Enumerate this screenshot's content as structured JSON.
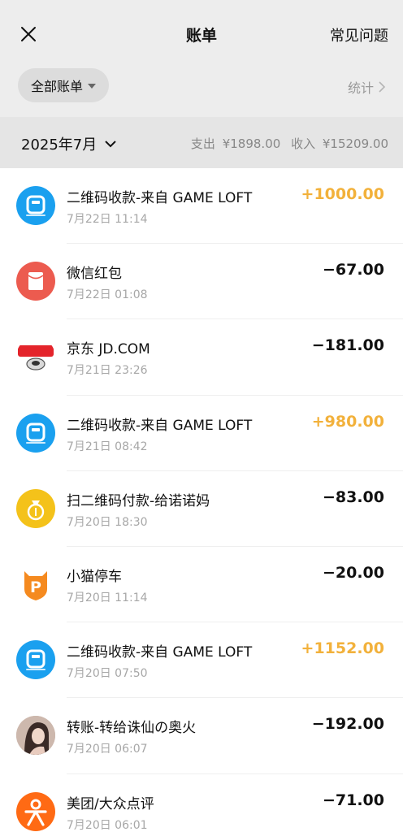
{
  "header": {
    "title": "账单",
    "faq_label": "常见问题"
  },
  "filter": {
    "all_bills_label": "全部账单",
    "stats_label": "统计"
  },
  "month_bar": {
    "month_label": "2025年7月",
    "expense_label": "支出",
    "expense_value": "¥1898.00",
    "income_label": "收入",
    "income_value": "¥15209.00"
  },
  "colors": {
    "income_amount": "#f2b13b",
    "gameloft_icon": "#1aa0ef",
    "red_packet_icon": "#ec5b4f",
    "scan_icon": "#f4c21a",
    "meituan_icon": "#ff6a14"
  },
  "transactions": [
    {
      "icon": "gameloft-icon",
      "name": "二维码收款-来自 GAME LOFT",
      "time": "7月22日 11:14",
      "amount": "+1000.00",
      "type": "income"
    },
    {
      "icon": "red-packet-icon",
      "name": "微信红包",
      "time": "7月22日 01:08",
      "amount": "−67.00",
      "type": "expense"
    },
    {
      "icon": "jd-logo-icon",
      "name": "京东 JD.COM",
      "time": "7月21日 23:26",
      "amount": "−181.00",
      "type": "expense"
    },
    {
      "icon": "gameloft-icon",
      "name": "二维码收款-来自 GAME LOFT",
      "time": "7月21日 08:42",
      "amount": "+980.00",
      "type": "income"
    },
    {
      "icon": "money-bag-icon",
      "name": "扫二维码付款-给诺诺妈",
      "time": "7月20日 18:30",
      "amount": "−83.00",
      "type": "expense"
    },
    {
      "icon": "parking-icon",
      "name": "小猫停车",
      "time": "7月20日 11:14",
      "amount": "−20.00",
      "type": "expense"
    },
    {
      "icon": "gameloft-icon",
      "name": "二维码收款-来自 GAME LOFT",
      "time": "7月20日 07:50",
      "amount": "+1152.00",
      "type": "income"
    },
    {
      "icon": "user-avatar-icon",
      "name": "转账-转给诛仙の奥火",
      "time": "7月20日 06:07",
      "amount": "−192.00",
      "type": "expense"
    },
    {
      "icon": "meituan-icon",
      "name": "美团/大众点评",
      "time": "7月20日 06:01",
      "amount": "−71.00",
      "type": "expense"
    }
  ]
}
